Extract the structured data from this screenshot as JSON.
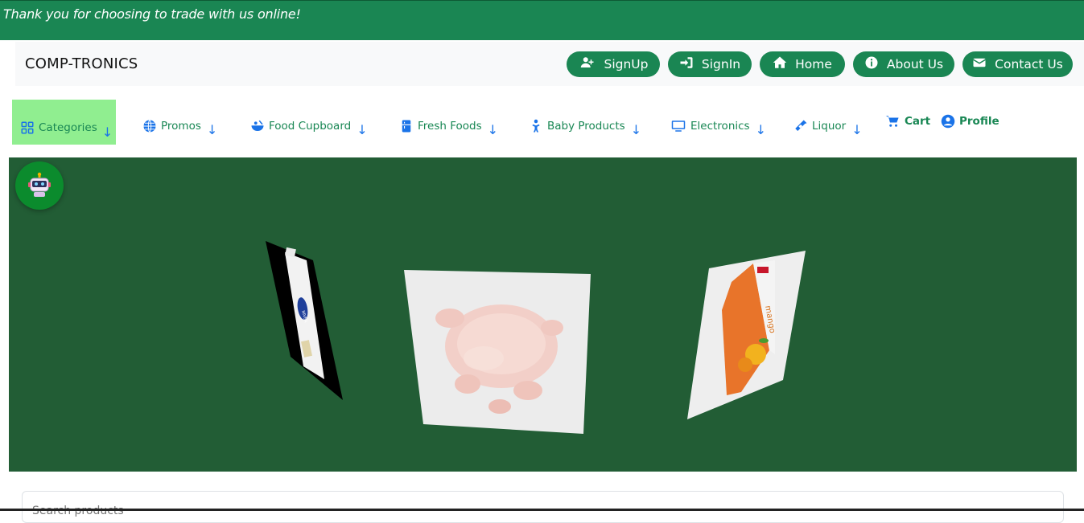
{
  "banner": {
    "message": "Thank you for choosing to trade with us online!"
  },
  "header": {
    "brand": "COMP-TRONICS",
    "buttons": {
      "signup": "SignUp",
      "signin": "SignIn",
      "home": "Home",
      "about": "About Us",
      "contact": "Contact Us"
    }
  },
  "nav": {
    "categories": "Categories",
    "promos": "Promos",
    "food_cupboard": "Food Cupboard",
    "fresh_foods": "Fresh Foods",
    "baby_products": "Baby Products",
    "electronics": "Electronics",
    "liquor": "Liquor",
    "cart": "Cart",
    "profile": "Profile",
    "arrow": "↓"
  },
  "carousel": {
    "slides": [
      "lotion-bottle",
      "whole-chicken",
      "mango-juice-carton"
    ],
    "background": "#225d35"
  },
  "search": {
    "placeholder": "Search products"
  },
  "colors": {
    "brand_green": "#1a8653",
    "link_blue": "#1a73e8",
    "active_green": "#90ee90"
  }
}
